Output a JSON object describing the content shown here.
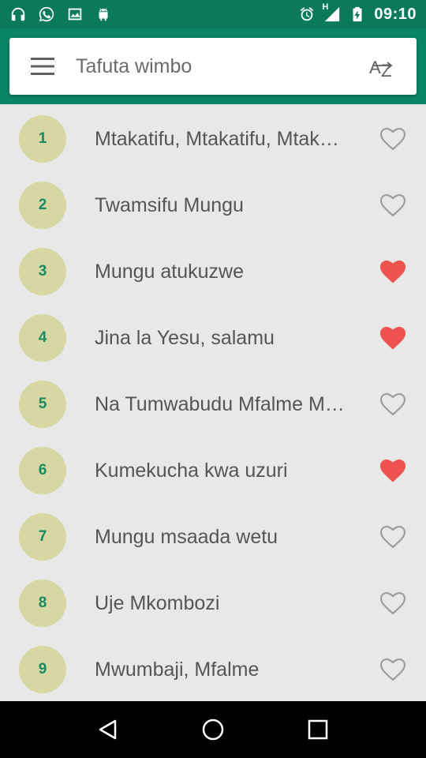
{
  "status_bar": {
    "time": "09:10",
    "network_label": "H",
    "left_icons": [
      "headphones-icon",
      "whatsapp-icon",
      "image-icon",
      "android-icon"
    ],
    "right_icons": [
      "alarm-icon",
      "signal-icon",
      "battery-charging-icon"
    ]
  },
  "toolbar": {
    "search_placeholder": "Tafuta wimbo",
    "menu_icon": "hamburger-menu-icon",
    "sort_icon": "sort-az-icon"
  },
  "colors": {
    "status_bar": "#0a7a5a",
    "app_bar": "#0a8565",
    "circle_bg": "#d6d7a3",
    "circle_text": "#1a8a62",
    "heart_filled": "#ef5350",
    "heart_outline": "#9e9e9e"
  },
  "songs": [
    {
      "number": "1",
      "title": "Mtakatifu, Mtakatifu, Mtakatifu",
      "favorite": false
    },
    {
      "number": "2",
      "title": "Twamsifu Mungu",
      "favorite": false
    },
    {
      "number": "3",
      "title": "Mungu atukuzwe",
      "favorite": true
    },
    {
      "number": "4",
      "title": "Jina la Yesu, salamu",
      "favorite": true
    },
    {
      "number": "5",
      "title": "Na Tumwabudu Mfalme Mtukufu",
      "favorite": false
    },
    {
      "number": "6",
      "title": "Kumekucha kwa uzuri",
      "favorite": true
    },
    {
      "number": "7",
      "title": "Mungu msaada wetu",
      "favorite": false
    },
    {
      "number": "8",
      "title": "Uje Mkombozi",
      "favorite": false
    },
    {
      "number": "9",
      "title": "Mwumbaji, Mfalme",
      "favorite": false
    }
  ],
  "nav_bar": {
    "back_icon": "back-triangle-icon",
    "home_icon": "home-circle-icon",
    "recents_icon": "recents-square-icon"
  }
}
